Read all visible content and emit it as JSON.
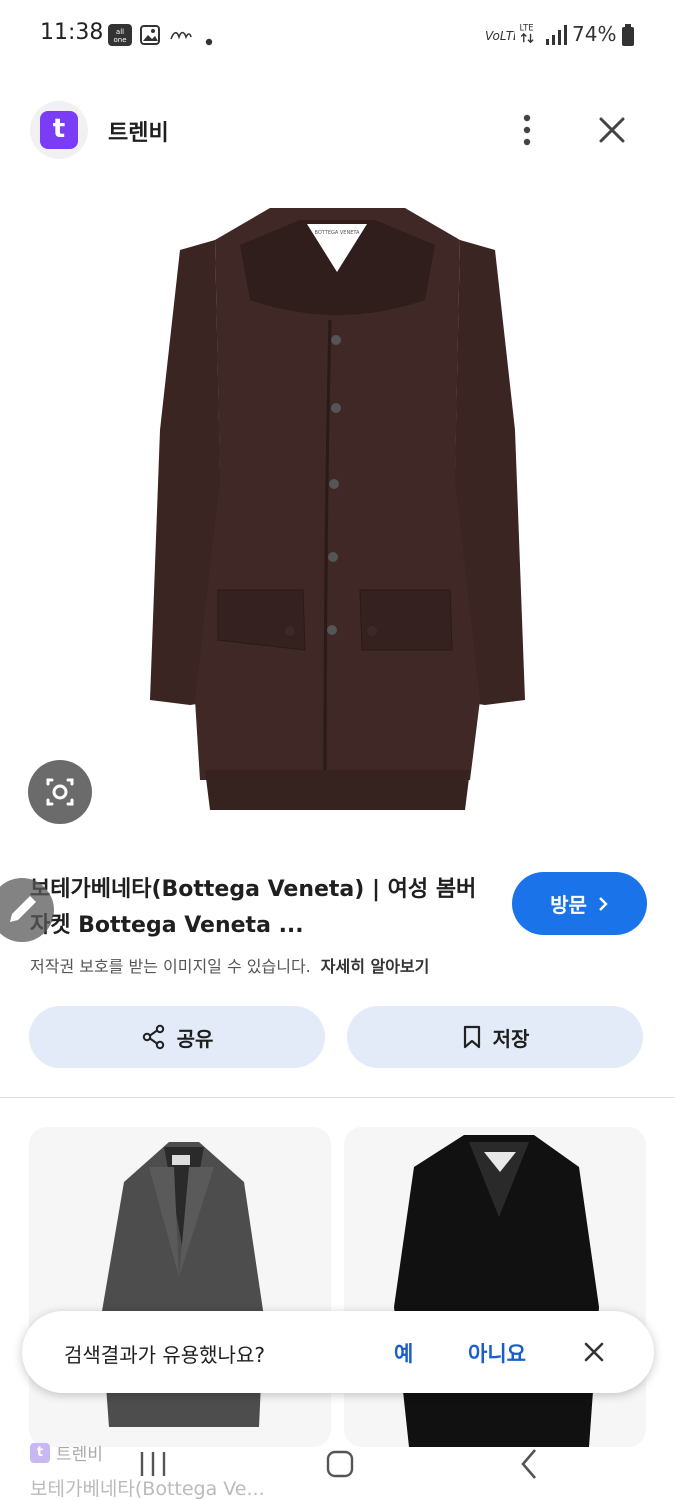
{
  "status_bar": {
    "time": "11:38",
    "battery": "74%",
    "icons": [
      "allone-icon",
      "gallery-icon",
      "app-notification-icon",
      "dot-icon",
      "volte-icon",
      "lte-icon",
      "signal-icon",
      "battery-icon"
    ]
  },
  "header": {
    "app_logo_letter": "t",
    "app_name": "트렌비"
  },
  "main": {
    "title": "보테가베네타(Bottega Veneta) | 여성 봄버 자켓 Bottega Veneta ...",
    "visit_label": "방문",
    "copyright_text": "저작권 보호를 받는 이미지일 수 있습니다.",
    "learn_more": "자세히 알아보기"
  },
  "actions": {
    "share_label": "공유",
    "save_label": "저장"
  },
  "related": {
    "source_name": "트렌비",
    "source_logo_letter": "t",
    "first_title": "보테가베네타(Bottega Ve..."
  },
  "feedback": {
    "question": "검색결과가 유용했나요?",
    "yes": "예",
    "no": "아니요"
  },
  "colors": {
    "accent": "#1a73e8",
    "brand": "#7a3cf5",
    "pill_bg": "#e3ebf8"
  }
}
